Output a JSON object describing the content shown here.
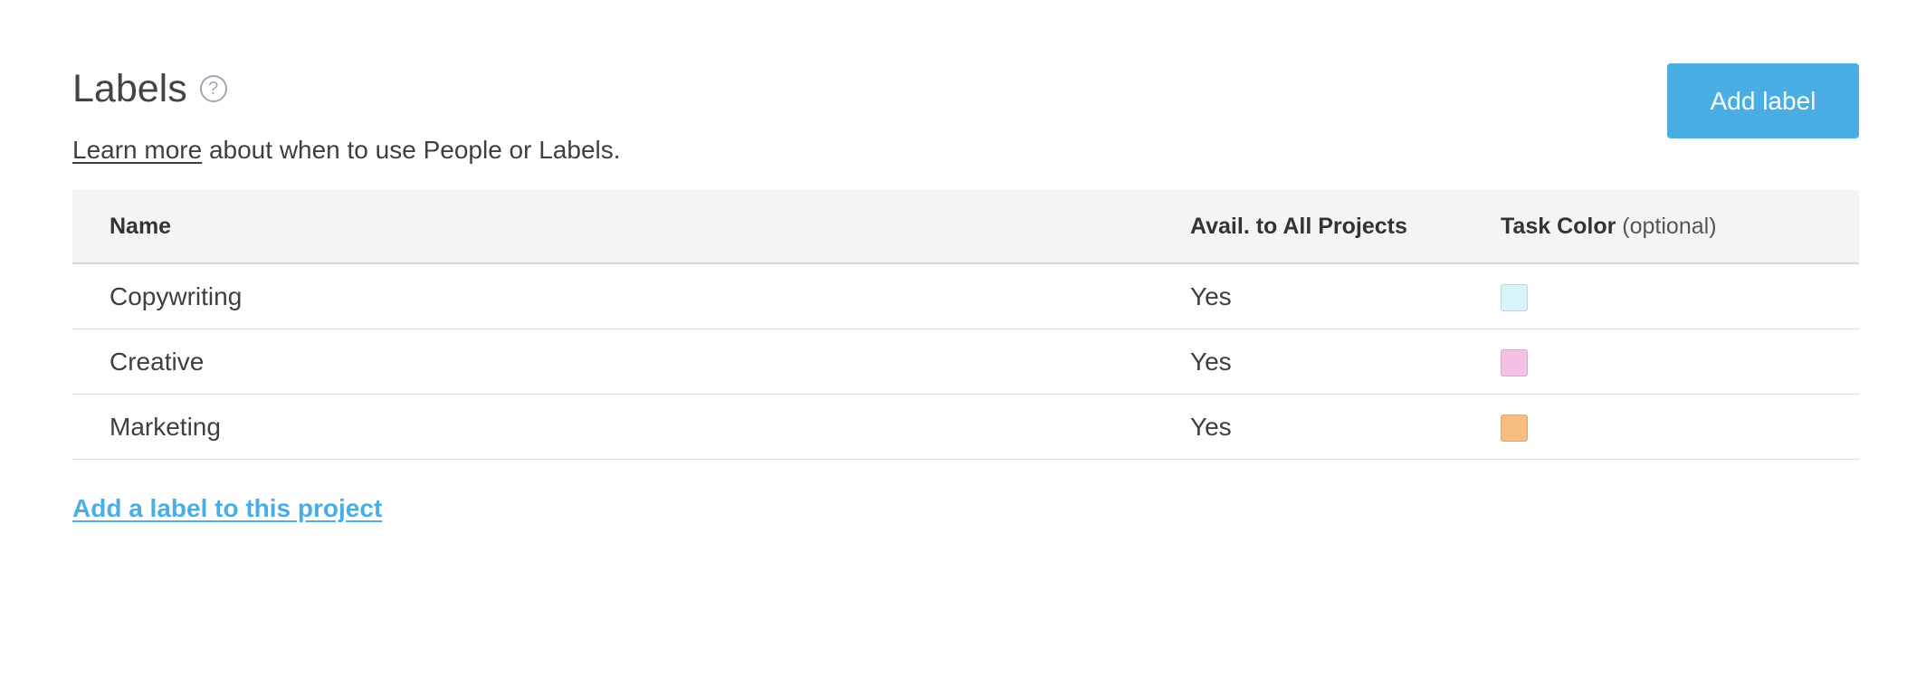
{
  "header": {
    "title": "Labels",
    "help_icon": "question-mark-circle-icon",
    "subtitle_link": "Learn more",
    "subtitle_text": " about when to use People or Labels.",
    "add_button_label": "Add label"
  },
  "table": {
    "columns": {
      "name": "Name",
      "avail": "Avail. to All Projects",
      "color": "Task Color",
      "color_hint": "(optional)"
    },
    "rows": [
      {
        "name": "Copywriting",
        "avail": "Yes",
        "color": "#d9f3fb"
      },
      {
        "name": "Creative",
        "avail": "Yes",
        "color": "#f3c1e3"
      },
      {
        "name": "Marketing",
        "avail": "Yes",
        "color": "#f5bd82"
      }
    ]
  },
  "footer": {
    "add_link": "Add a label to this project"
  },
  "colors": {
    "accent": "#4aaee5",
    "header_bg": "#f4f4f4"
  }
}
